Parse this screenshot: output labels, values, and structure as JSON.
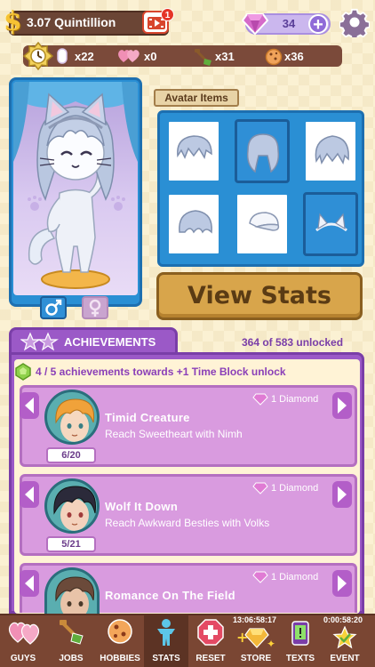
{
  "top_bar": {
    "money": "3.07 Quintillion",
    "video_badge": "1",
    "gems": "34"
  },
  "resources": [
    {
      "icon": "token-icon",
      "value": "x22"
    },
    {
      "icon": "hearts-icon",
      "value": "x0"
    },
    {
      "icon": "shovel-icon",
      "value": "x31"
    },
    {
      "icon": "cookie-icon",
      "value": "x36"
    }
  ],
  "avatar_items": {
    "label": "Avatar Items",
    "cells": [
      {
        "item": "hair-spiky",
        "selected": false
      },
      {
        "item": "hair-long",
        "selected": true
      },
      {
        "item": "hair-messy",
        "selected": false
      },
      {
        "item": "hair-curly",
        "selected": false
      },
      {
        "item": "cap",
        "selected": false
      },
      {
        "item": "cat-ears",
        "selected": true
      }
    ]
  },
  "view_stats_label": "View Stats",
  "achievements": {
    "tab_label": "ACHIEVEMENTS",
    "unlocked": "364 of 583 unlocked",
    "progress_text": "4 / 5 achievements towards +1 Time Block unlock",
    "cards": [
      {
        "title": "Timid Creature",
        "desc": "Reach Sweetheart with Nimh",
        "reward": "1 Diamond",
        "progress": "6/20",
        "hair": "#f0a23a"
      },
      {
        "title": "Wolf It Down",
        "desc": "Reach Awkward Besties with Volks",
        "reward": "1 Diamond",
        "progress": "5/21",
        "hair": "#2b2a3a"
      },
      {
        "title": "Romance On The Field",
        "desc": "",
        "reward": "1 Diamond",
        "progress": "",
        "hair": "#6b4a3a"
      }
    ]
  },
  "nav": {
    "items": [
      {
        "label": "GUYS",
        "icon": "hearts-icon"
      },
      {
        "label": "JOBS",
        "icon": "shovel-icon"
      },
      {
        "label": "HOBBIES",
        "icon": "ball-icon"
      },
      {
        "label": "STATS",
        "icon": "person-icon"
      },
      {
        "label": "RESET",
        "icon": "reset-icon"
      },
      {
        "label": "STORE",
        "icon": "store-icon"
      },
      {
        "label": "TEXTS",
        "icon": "phone-icon"
      },
      {
        "label": "EVENT",
        "icon": "star-icon"
      }
    ],
    "store_timer": "13:06:58:17",
    "event_timer": "0:00:58:20"
  }
}
